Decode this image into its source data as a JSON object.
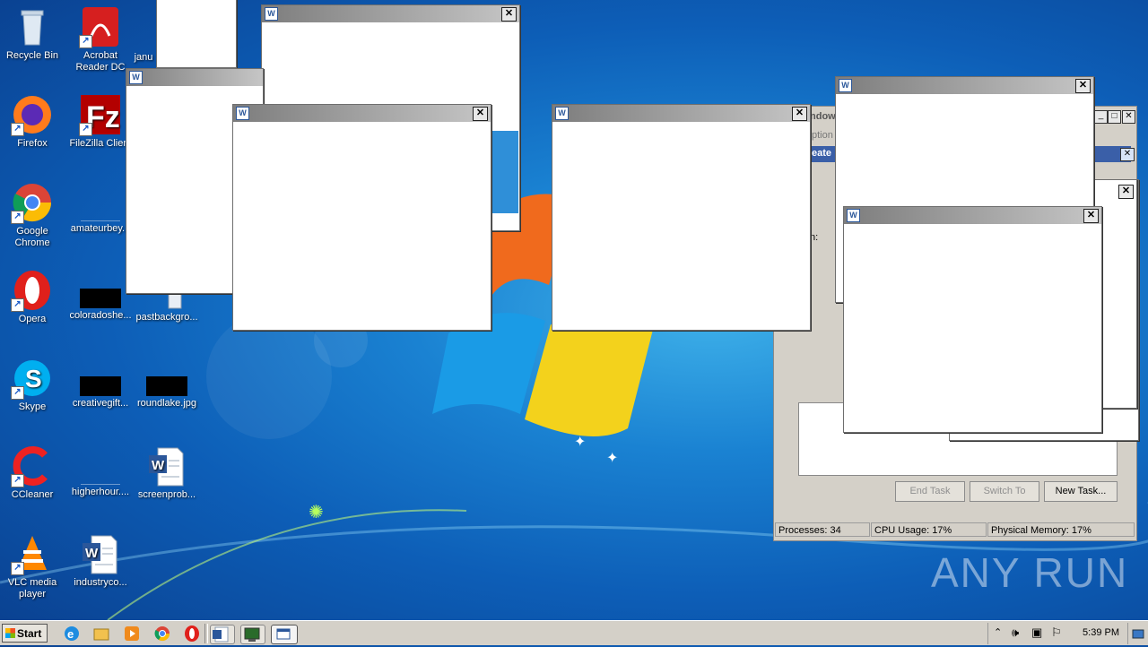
{
  "desktop_icons": [
    {
      "id": "recycle-bin",
      "label": "Recycle Bin",
      "icon": "recycle-bin-icon",
      "shortcut": false
    },
    {
      "id": "acrobat",
      "label": "Acrobat Reader DC",
      "icon": "acrobat-icon",
      "shortcut": true
    },
    {
      "id": "janu",
      "label": "janu",
      "icon": "file-icon",
      "shortcut": false
    },
    {
      "id": "firefox",
      "label": "Firefox",
      "icon": "firefox-icon",
      "shortcut": true
    },
    {
      "id": "filezilla",
      "label": "FileZilla Client",
      "icon": "filezilla-icon",
      "shortcut": true
    },
    {
      "id": "chrome",
      "label": "Google Chrome",
      "icon": "chrome-icon",
      "shortcut": true
    },
    {
      "id": "amateurbey",
      "label": "amateurbey...",
      "icon": "image-file-icon",
      "shortcut": false
    },
    {
      "id": "opera",
      "label": "Opera",
      "icon": "opera-icon",
      "shortcut": true
    },
    {
      "id": "coloradoshe",
      "label": "coloradoshe...",
      "icon": "image-file-icon",
      "shortcut": false
    },
    {
      "id": "pastbackgro",
      "label": "pastbackgro...",
      "icon": "text-file-icon",
      "shortcut": false
    },
    {
      "id": "skype",
      "label": "Skype",
      "icon": "skype-icon",
      "shortcut": true
    },
    {
      "id": "creativegift",
      "label": "creativegift...",
      "icon": "image-file-icon",
      "shortcut": false
    },
    {
      "id": "roundlake",
      "label": "roundlake.jpg",
      "icon": "image-file-icon",
      "shortcut": false
    },
    {
      "id": "ccleaner",
      "label": "CCleaner",
      "icon": "ccleaner-icon",
      "shortcut": true
    },
    {
      "id": "higherhour",
      "label": "higherhour....",
      "icon": "image-file-icon",
      "shortcut": false
    },
    {
      "id": "screenprob",
      "label": "screenprob...",
      "icon": "word-document-icon",
      "shortcut": false
    },
    {
      "id": "vlc",
      "label": "VLC media player",
      "icon": "vlc-icon",
      "shortcut": true
    },
    {
      "id": "industryco",
      "label": "industryco...",
      "icon": "word-document-icon",
      "shortcut": false
    }
  ],
  "task_manager": {
    "title_fragment": "ndows",
    "menu_fragment": "ption",
    "row_fragment": "eate",
    "field_fragment": "n:",
    "buttons": {
      "end_task": "End Task",
      "switch_to": "Switch To",
      "new_task": "New Task..."
    },
    "status": {
      "processes": "Processes: 34",
      "cpu": "CPU Usage: 17%",
      "memory": "Physical Memory: 17%"
    }
  },
  "taskbar": {
    "start_label": "Start",
    "clock": "5:39 PM",
    "quick_launch": [
      "ie-icon",
      "explorer-icon",
      "media-player-icon",
      "chrome-icon",
      "opera-icon"
    ],
    "tasks": [
      "word-task-icon",
      "task-manager-task-icon",
      "window-task-icon"
    ]
  },
  "watermark": "ANY RUN",
  "colors": {
    "accent": "#1a82d2",
    "taskbar": "#d4d0c8",
    "titlebar_dark": "#7d7d7d",
    "titlebar_light": "#c6c6c6"
  }
}
